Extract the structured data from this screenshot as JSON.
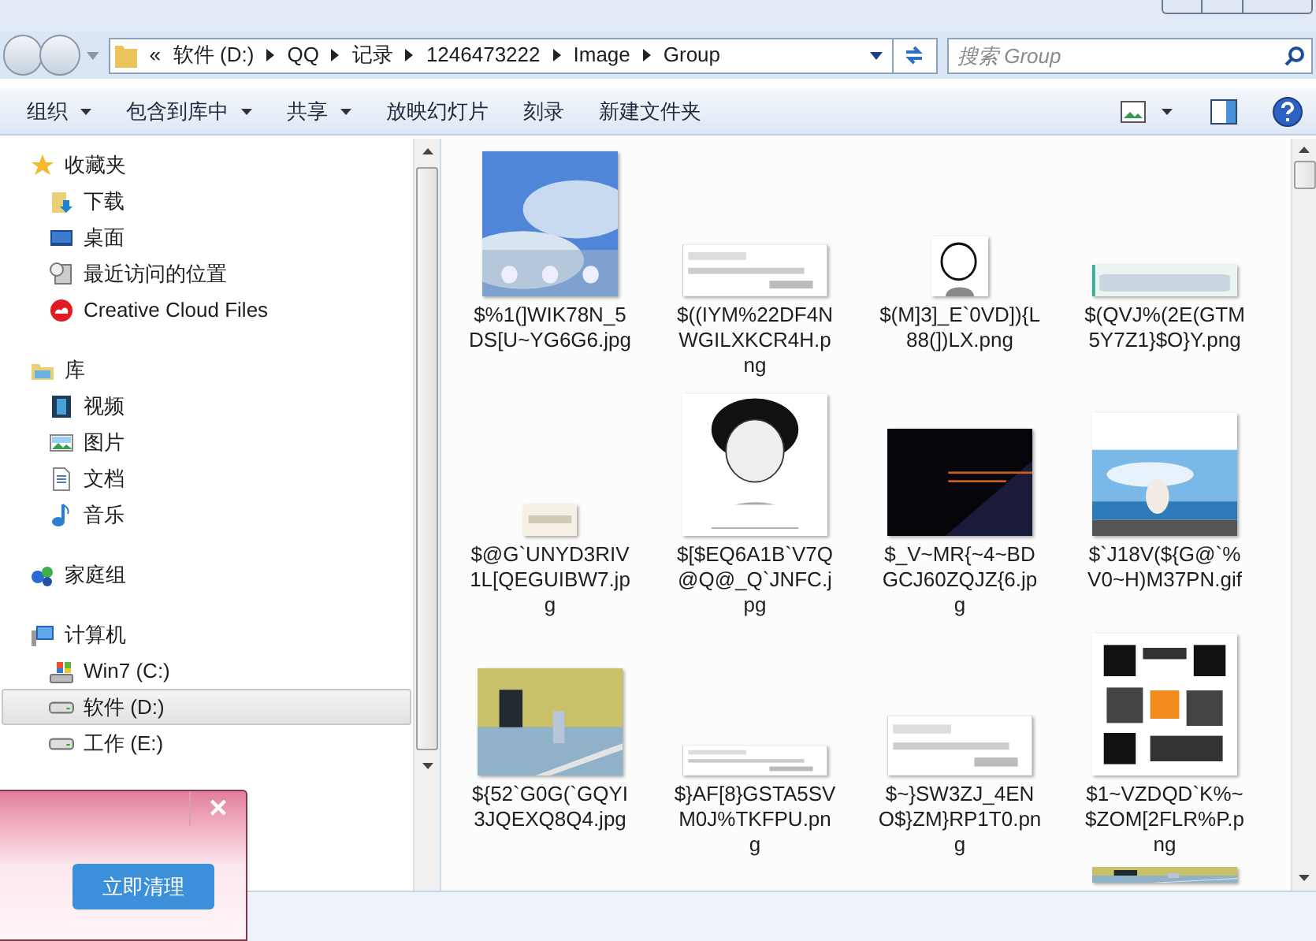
{
  "address_bar": {
    "overflow": "«",
    "segments": [
      "软件 (D:)",
      "QQ",
      "记录",
      "1246473222",
      "Image",
      "Group"
    ]
  },
  "search": {
    "placeholder": "搜索 Group"
  },
  "toolbar": {
    "items": [
      {
        "label": "组织",
        "dropdown": true
      },
      {
        "label": "包含到库中",
        "dropdown": true
      },
      {
        "label": "共享",
        "dropdown": true
      },
      {
        "label": "放映幻灯片",
        "dropdown": false
      },
      {
        "label": "刻录",
        "dropdown": false
      },
      {
        "label": "新建文件夹",
        "dropdown": false
      }
    ]
  },
  "nav": [
    {
      "label": "收藏夹",
      "children": [
        {
          "label": "下载",
          "selected": false
        },
        {
          "label": "桌面",
          "selected": false
        },
        {
          "label": "最近访问的位置",
          "selected": false
        },
        {
          "label": "Creative Cloud Files",
          "selected": false
        }
      ]
    },
    {
      "label": "库",
      "children": [
        {
          "label": "视频",
          "selected": false
        },
        {
          "label": "图片",
          "selected": false
        },
        {
          "label": "文档",
          "selected": false
        },
        {
          "label": "音乐",
          "selected": false
        }
      ]
    },
    {
      "label": "家庭组"
    },
    {
      "label": "计算机",
      "children": [
        {
          "label": "Win7 (C:)",
          "selected": false
        },
        {
          "label": "软件 (D:)",
          "selected": true
        },
        {
          "label": "工作 (E:)",
          "selected": false
        }
      ]
    }
  ],
  "files": [
    {
      "name": "$%1(]WIK78N_5DS[U~YG6G6.jpg"
    },
    {
      "name": "$((IYM%22DF4NWGILXKCR4H.png"
    },
    {
      "name": "$(M]3]_E`0VD]){L88(])LX.png"
    },
    {
      "name": "$(QVJ%(2E(GTM5Y7Z1}$O}Y.png"
    },
    {
      "name": "$@G`UNYD3RIV1L[QEGUIBW7.jpg"
    },
    {
      "name": "$[$EQ6A1B`V7Q@Q@_Q`JNFC.jpg"
    },
    {
      "name": "$_V~MR{~4~BDGCJ60ZQJZ{6.jpg"
    },
    {
      "name": "$`J18V(${G@`%V0~H)M37PN.gif"
    },
    {
      "name": "${52`G0G(`GQYI3JQEXQ8Q4.jpg"
    },
    {
      "name": "$}AF[8}GSTA5SVM0J%TKFPU.png"
    },
    {
      "name": "$~}SW3ZJ_4ENO$}ZM}RP1T0.png"
    },
    {
      "name": "$1~VZDQD`K%~$ZOM[2FLR%P.png"
    }
  ],
  "popup": {
    "button": "立即清理",
    "close": "×"
  }
}
